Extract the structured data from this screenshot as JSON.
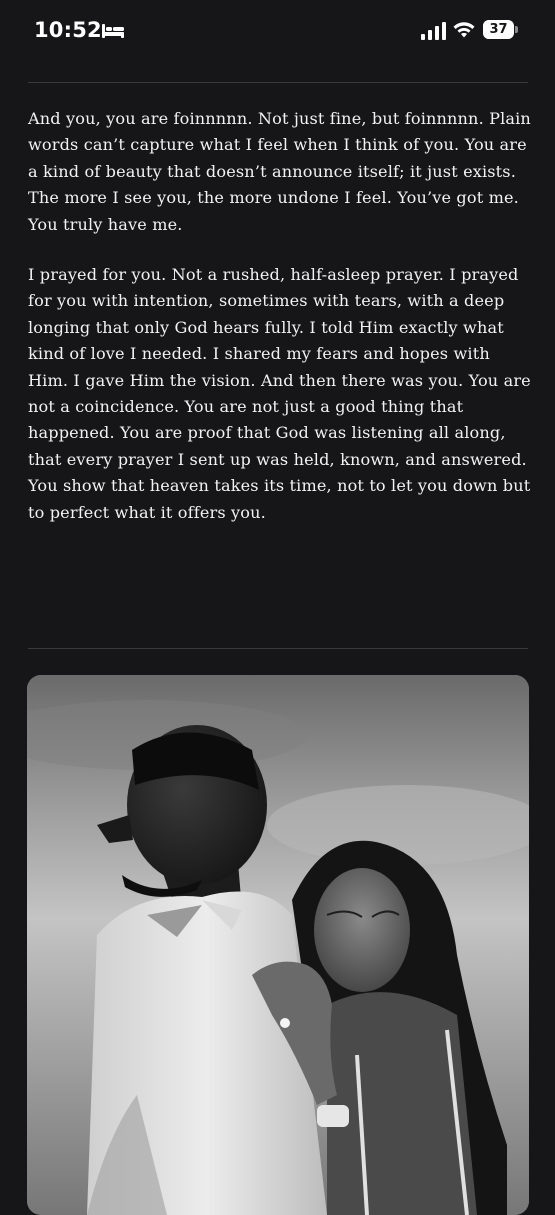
{
  "status_bar": {
    "time": "10:52",
    "battery_percent": "37",
    "battery_level": 0.37,
    "icons": [
      "bed-icon",
      "signal-icon",
      "wifi-icon",
      "battery-icon"
    ]
  },
  "article": {
    "paragraphs": [
      "And you, you are foinnnnn. Not just fine, but foinnnnn. Plain words can’t capture what I feel when I think of you. You are a kind of beauty that doesn’t announce itself; it just exists. The more I see you, the more undone I feel. You’ve got me. You truly have me.",
      "I prayed for you. Not a rushed, half-asleep prayer. I prayed for you with intention, sometimes with tears, with a deep longing that only God hears fully. I told Him exactly what kind of love I needed. I shared my fears and hopes with Him. I gave Him the vision. And then there was you. You are not a coincidence. You are not just a good thing that happened. You are proof that God was listening all along, that every prayer I sent up was held, known, and answered. You show that heaven takes its time, not to let you down but to perfect what it offers you."
    ]
  },
  "photo": {
    "style": "black-and-white",
    "subject": "couple embracing"
  }
}
